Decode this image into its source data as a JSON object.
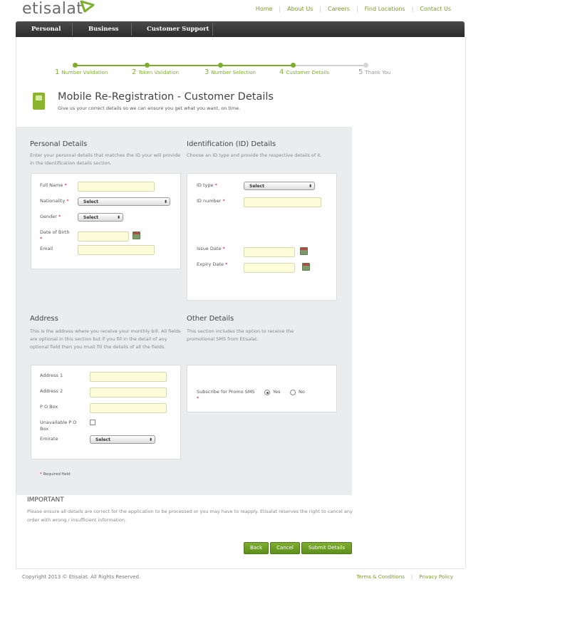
{
  "header": {
    "logo_text": "etisalat",
    "top_links": [
      "Home",
      "About Us",
      "Careers",
      "Find Locations",
      "Contact Us"
    ]
  },
  "nav": {
    "items": [
      "Personal",
      "Business",
      "Customer Support"
    ]
  },
  "progress": {
    "steps": [
      {
        "num": "1",
        "label": "Number Validation"
      },
      {
        "num": "2",
        "label": "Token Validation"
      },
      {
        "num": "3",
        "label": "Number Selection"
      },
      {
        "num": "4",
        "label": "Customer Details"
      },
      {
        "num": "5",
        "label": "Thank You"
      }
    ],
    "current_step": 4
  },
  "page": {
    "title": "Mobile Re-Registration - Customer Details",
    "subtitle": "Give us your correct details so we can ensure you get what you want, on time."
  },
  "personal": {
    "title": "Personal Details",
    "desc": "Enter your personal details that matches the ID your will provide in the Identification details section.",
    "full_name_label": "Full Name",
    "nationality_label": "Nationality",
    "nationality_value": "Select",
    "gender_label": "Gender",
    "gender_value": "Select",
    "dob_label": "Date of Birth",
    "email_label": "Email"
  },
  "identification": {
    "title": "Identification (ID) Details",
    "desc": "Choose an ID type and provide the respective details of it.",
    "id_type_label": "ID type",
    "id_type_value": "Select",
    "id_number_label": "ID number",
    "issue_date_label": "Issue Date",
    "expiry_date_label": "Expiry Date"
  },
  "address": {
    "title": "Address",
    "desc": "This is the address where you receive your monthly bill. All fields are optional in this section but if you fill in the detail of any optional field then you must fill the details of all the fields.",
    "address1_label": "Address 1",
    "address2_label": "Address 2",
    "pobox_label": "P O Box",
    "unavailable_pobox_label": "Unavailable P O Box",
    "emirate_label": "Emirate",
    "emirate_value": "Select"
  },
  "other": {
    "title": "Other Details",
    "desc": "This section includes the option to receive the promotional SMS from Etisalat.",
    "promo_label": "Subscribe for Promo SMS",
    "yes_label": "Yes",
    "no_label": "No"
  },
  "required_note": "Required field",
  "required_mark": "*",
  "important": {
    "title": "IMPORTANT",
    "text": "Please ensure all details are correct for the application to be processed or you may have to reapply. Etisalat reserves the right to cancel any order with wrong / insufficient information."
  },
  "buttons": {
    "back": "Back",
    "cancel": "Cancel",
    "submit": "Submit Details"
  },
  "footer": {
    "copyright": "Copyright 2013 © Etisalat. All Rights Reserved.",
    "links": [
      "Terms & Conditions",
      "Privacy Policy"
    ]
  },
  "colors": {
    "brand_green": "#7fae2f",
    "required_red": "#c8102e",
    "field_bg": "#fdfdd9"
  }
}
